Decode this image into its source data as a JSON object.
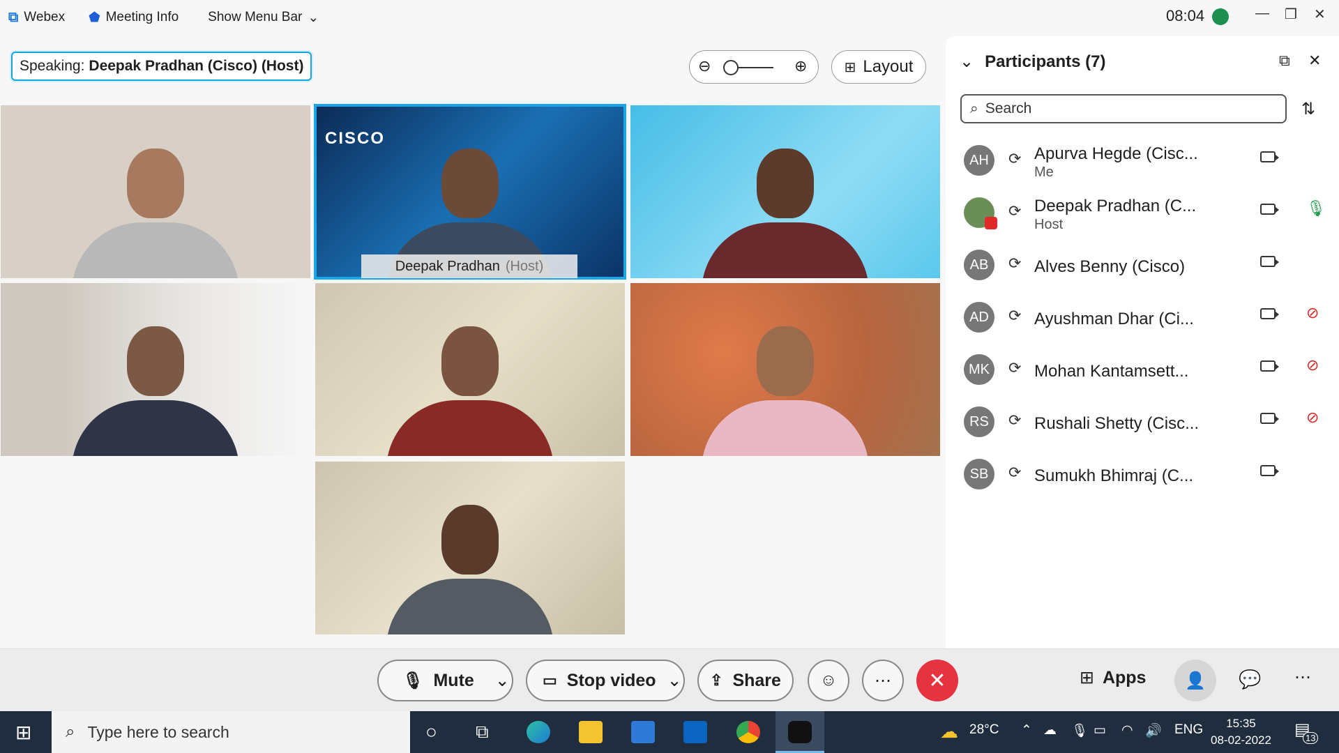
{
  "topbar": {
    "app_name": "Webex",
    "meeting_info": "Meeting Info",
    "show_menu_bar": "Show Menu Bar",
    "time": "08:04"
  },
  "speaking": {
    "label": "Speaking:",
    "name": "Deepak Pradhan (Cisco) (Host)"
  },
  "layout": {
    "label": "Layout"
  },
  "video_tiles": [
    {
      "name": "",
      "role": ""
    },
    {
      "name": "Deepak Pradhan",
      "role": "(Host)",
      "active": true
    },
    {
      "name": "",
      "role": ""
    },
    {
      "name": "",
      "role": ""
    },
    {
      "name": "",
      "role": ""
    },
    {
      "name": "",
      "role": ""
    },
    {
      "name": "",
      "role": ""
    }
  ],
  "participants": {
    "title": "Participants (7)",
    "search_placeholder": "Search",
    "list": [
      {
        "initials": "AH",
        "name": "Apurva Hegde (Cisc...",
        "role": "Me",
        "mic": "none"
      },
      {
        "initials": "",
        "name": "Deepak Pradhan (C...",
        "role": "Host",
        "mic": "on"
      },
      {
        "initials": "AB",
        "name": "Alves Benny (Cisco)",
        "role": "",
        "mic": "none"
      },
      {
        "initials": "AD",
        "name": "Ayushman Dhar (Ci...",
        "role": "",
        "mic": "muted"
      },
      {
        "initials": "MK",
        "name": "Mohan Kantamsett...",
        "role": "",
        "mic": "muted"
      },
      {
        "initials": "RS",
        "name": "Rushali Shetty (Cisc...",
        "role": "",
        "mic": "muted"
      },
      {
        "initials": "SB",
        "name": "Sumukh Bhimraj (C...",
        "role": "",
        "mic": "none"
      }
    ]
  },
  "controls": {
    "mute": "Mute",
    "stop_video": "Stop video",
    "share": "Share",
    "apps": "Apps"
  },
  "taskbar": {
    "search_placeholder": "Type here to search",
    "weather": "28°C",
    "lang": "ENG",
    "time": "15:35",
    "date": "08-02-2022",
    "notifications": "13"
  },
  "colors": {
    "accent": "#1aa7e8",
    "end_call": "#e53340",
    "mic_on": "#1e9d4e",
    "mic_muted": "#d42a2a"
  }
}
